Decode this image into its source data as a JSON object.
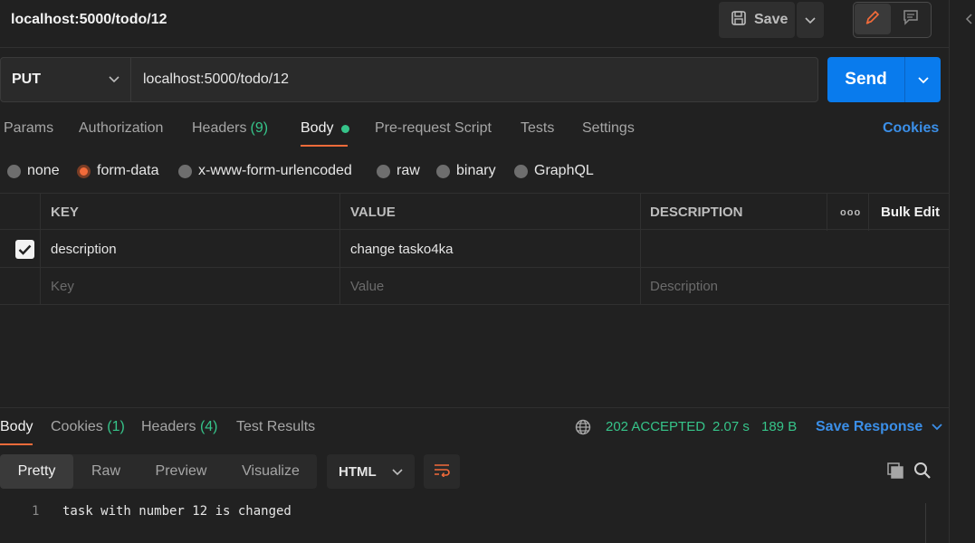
{
  "request": {
    "title": "localhost:5000/todo/12",
    "save_label": "Save",
    "method": "PUT",
    "url": "localhost:5000/todo/12",
    "send_label": "Send"
  },
  "tabs": {
    "params": "Params",
    "authorization": "Authorization",
    "headers": "Headers",
    "headers_count": "(9)",
    "body": "Body",
    "prerequest": "Pre-request Script",
    "tests": "Tests",
    "settings": "Settings",
    "cookies": "Cookies"
  },
  "body_types": {
    "none": "none",
    "form_data": "form-data",
    "urlencoded": "x-www-form-urlencoded",
    "raw": "raw",
    "binary": "binary",
    "graphql": "GraphQL",
    "selected": "form-data"
  },
  "table": {
    "headers": {
      "key": "KEY",
      "value": "VALUE",
      "description": "DESCRIPTION",
      "more": "ooo",
      "bulk_edit": "Bulk Edit"
    },
    "rows": [
      {
        "checked": true,
        "key": "description",
        "value": "change tasko4ka",
        "description": ""
      }
    ],
    "placeholders": {
      "key": "Key",
      "value": "Value",
      "description": "Description"
    }
  },
  "response": {
    "tabs": {
      "body": "Body",
      "cookies": "Cookies",
      "cookies_count": "(1)",
      "headers": "Headers",
      "headers_count": "(4)",
      "test_results": "Test Results"
    },
    "status": "202 ACCEPTED",
    "time": "2.07 s",
    "size": "189 B",
    "save_response": "Save Response",
    "views": {
      "pretty": "Pretty",
      "raw": "Raw",
      "preview": "Preview",
      "visualize": "Visualize"
    },
    "format": "HTML",
    "lines": [
      {
        "number": "1",
        "text": "task with number 12 is changed"
      }
    ]
  },
  "colors": {
    "accent": "#f26b3a",
    "primary": "#097bed",
    "success": "#36c48a",
    "link": "#3b8fe8"
  }
}
